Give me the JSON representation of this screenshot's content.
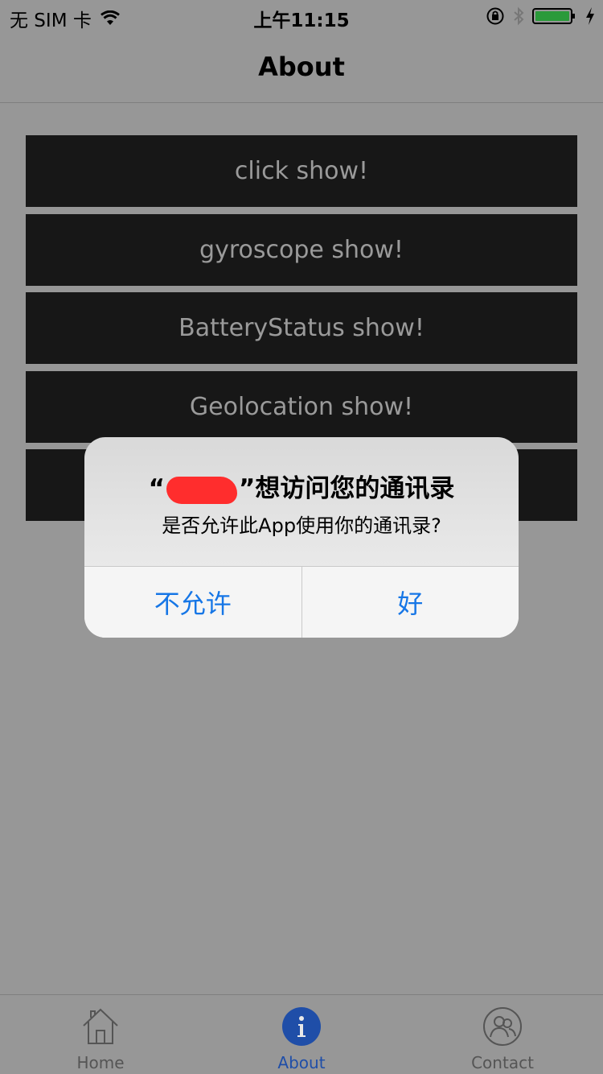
{
  "status_bar": {
    "carrier": "无 SIM 卡",
    "time": "上午11:15"
  },
  "nav": {
    "title": "About"
  },
  "buttons": [
    {
      "label": "click show!"
    },
    {
      "label": "gyroscope show!"
    },
    {
      "label": "BatteryStatus show!"
    },
    {
      "label": "Geolocation show!"
    },
    {
      "label": ""
    }
  ],
  "alert": {
    "title_prefix": "“",
    "title_suffix": "”想访问您的通讯录",
    "message": "是否允许此App使用你的通讯录?",
    "deny_label": "不允许",
    "allow_label": "好"
  },
  "tab_bar": {
    "tabs": [
      {
        "label": "Home",
        "icon": "home-icon"
      },
      {
        "label": "About",
        "icon": "info-icon"
      },
      {
        "label": "Contact",
        "icon": "contact-icon"
      }
    ],
    "active_color": "#1f4ea8"
  },
  "colors": {
    "background": "#979797",
    "button_bg": "#171717",
    "alert_action": "#1676e6",
    "battery": "#2a9a3a"
  }
}
